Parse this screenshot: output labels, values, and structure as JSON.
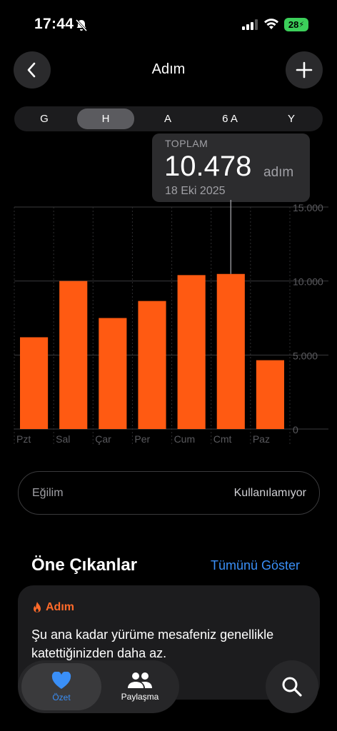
{
  "status_bar": {
    "time": "17:44",
    "battery": "28"
  },
  "header": {
    "title": "Adım"
  },
  "segments": [
    {
      "label": "G",
      "active": false
    },
    {
      "label": "H",
      "active": true
    },
    {
      "label": "A",
      "active": false
    },
    {
      "label": "6 A",
      "active": false
    },
    {
      "label": "Y",
      "active": false
    }
  ],
  "tooltip": {
    "label": "TOPLAM",
    "value": "10.478",
    "unit": "adım",
    "date": "18 Eki 2025"
  },
  "chart_data": {
    "type": "bar",
    "categories": [
      "Pzt",
      "Sal",
      "Çar",
      "Per",
      "Cum",
      "Cmt",
      "Paz"
    ],
    "values": [
      6200,
      10000,
      7500,
      8650,
      10400,
      10478,
      4650
    ],
    "ylim": [
      0,
      15000
    ],
    "y_ticks": [
      0,
      5000,
      10000,
      15000
    ],
    "y_tick_labels": [
      "0",
      "5.000",
      "10.000",
      "15.000"
    ],
    "selected_index": 5,
    "bar_color": "#ff5a12"
  },
  "trend": {
    "label": "Eğilim",
    "value": "Kullanılamıyor"
  },
  "highlights": {
    "title": "Öne Çıkanlar",
    "show_all": "Tümünü Göster",
    "card": {
      "tag": "Adım",
      "text": "Şu ana kadar yürüme mesafeniz genellikle katettiğinizden daha az."
    }
  },
  "tabbar": {
    "summary": "Özet",
    "sharing": "Paylaşma"
  },
  "colors": {
    "accent": "#3a8ff7",
    "bar": "#ff5a12",
    "tag": "#ff6a2a"
  }
}
